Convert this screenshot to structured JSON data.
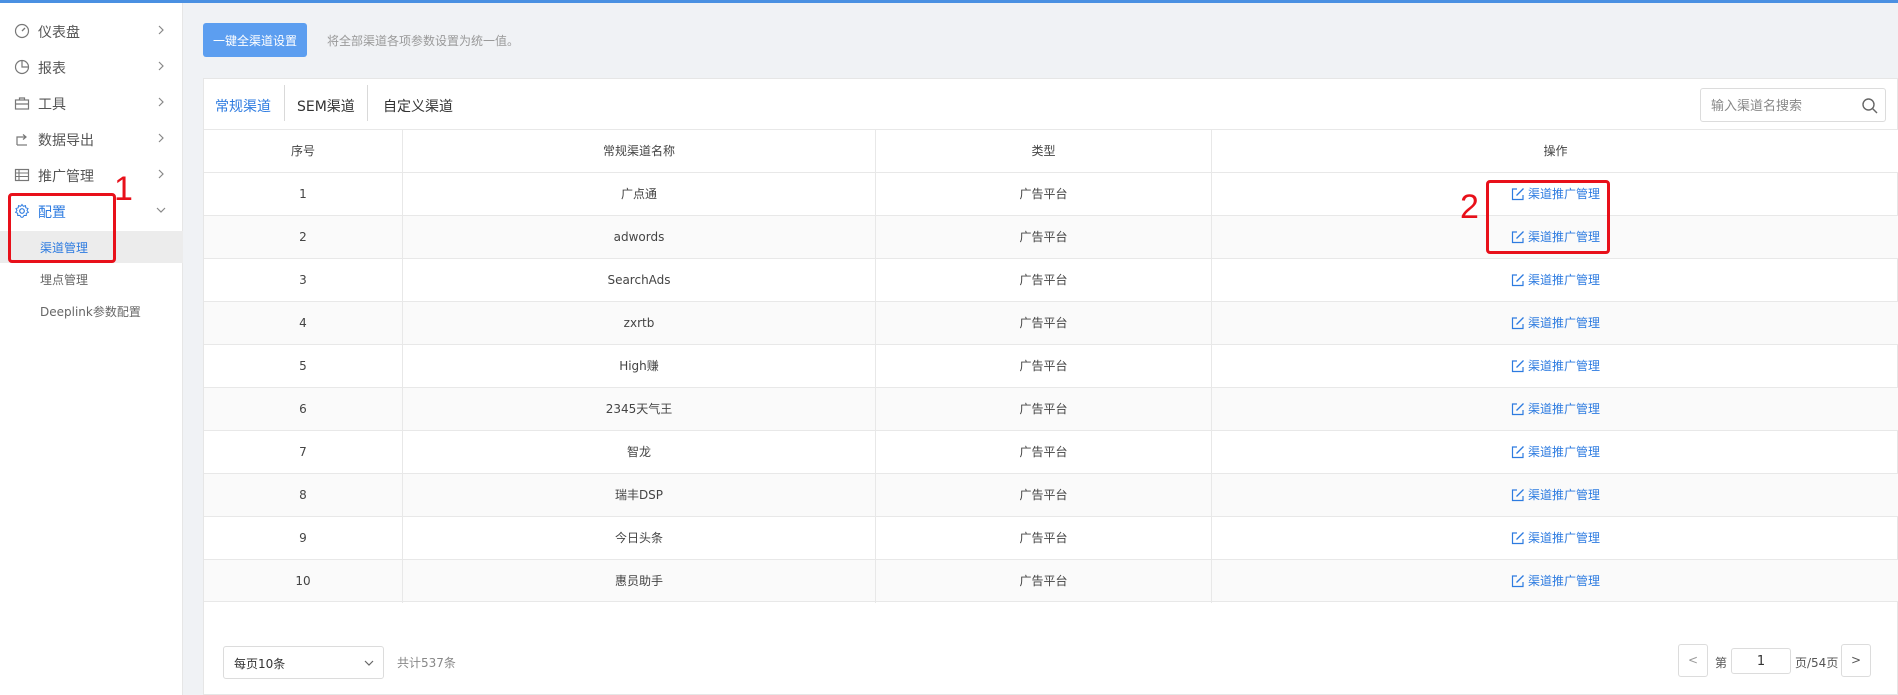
{
  "sidebar": {
    "items": [
      {
        "label": "仪表盘",
        "icon": "dashboard-icon"
      },
      {
        "label": "报表",
        "icon": "pie-chart-icon"
      },
      {
        "label": "工具",
        "icon": "toolbox-icon"
      },
      {
        "label": "数据导出",
        "icon": "export-icon"
      },
      {
        "label": "推广管理",
        "icon": "list-icon"
      },
      {
        "label": "配置",
        "icon": "gear-icon",
        "expanded": true
      }
    ],
    "subitems": [
      {
        "label": "渠道管理",
        "active": true
      },
      {
        "label": "埋点管理"
      },
      {
        "label": "Deeplink参数配置"
      }
    ]
  },
  "annotations": {
    "one": "1",
    "two": "2",
    "color": "#e8101a"
  },
  "toolbar": {
    "one_key_label": "一键全渠道设置",
    "hint": "将全部渠道各项参数设置为统一值。"
  },
  "tabs": [
    {
      "label": "常规渠道",
      "active": true
    },
    {
      "label": "SEM渠道"
    },
    {
      "label": "自定义渠道"
    }
  ],
  "search": {
    "placeholder": "输入渠道名搜索"
  },
  "table": {
    "headers": [
      "序号",
      "常规渠道名称",
      "类型",
      "操作"
    ],
    "rows": [
      {
        "no": "1",
        "name": "广点通",
        "type": "广告平台",
        "action": "渠道推广管理"
      },
      {
        "no": "2",
        "name": "adwords",
        "type": "广告平台",
        "action": "渠道推广管理"
      },
      {
        "no": "3",
        "name": "SearchAds",
        "type": "广告平台",
        "action": "渠道推广管理"
      },
      {
        "no": "4",
        "name": "zxrtb",
        "type": "广告平台",
        "action": "渠道推广管理"
      },
      {
        "no": "5",
        "name": "High赚",
        "type": "广告平台",
        "action": "渠道推广管理"
      },
      {
        "no": "6",
        "name": "2345天气王",
        "type": "广告平台",
        "action": "渠道推广管理"
      },
      {
        "no": "7",
        "name": "智龙",
        "type": "广告平台",
        "action": "渠道推广管理"
      },
      {
        "no": "8",
        "name": "瑞丰DSP",
        "type": "广告平台",
        "action": "渠道推广管理"
      },
      {
        "no": "9",
        "name": "今日头条",
        "type": "广告平台",
        "action": "渠道推广管理"
      },
      {
        "no": "10",
        "name": "惠员助手",
        "type": "广告平台",
        "action": "渠道推广管理"
      }
    ]
  },
  "pagination": {
    "page_size": "每页10条",
    "total": "共计537条",
    "prev": "<",
    "next": ">",
    "page_prefix": "第",
    "current_page": "1",
    "page_suffix": "页/54页"
  },
  "colors": {
    "accent": "#2d7be0",
    "button": "#5c9ef0",
    "topbar": "#4a90e2"
  }
}
